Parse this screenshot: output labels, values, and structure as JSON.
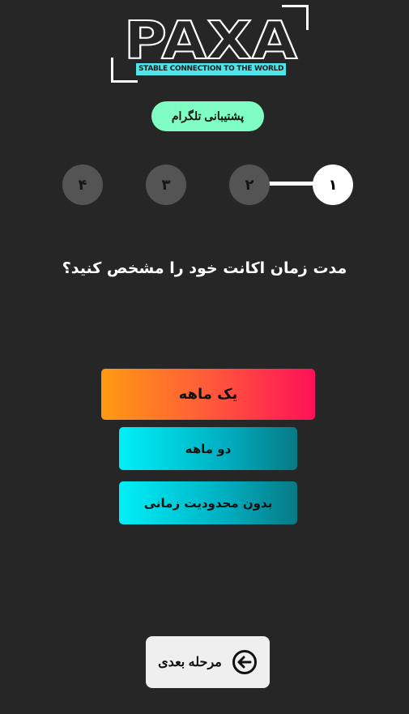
{
  "brand": {
    "name": "PAXA",
    "tagline": "STABLE CONNECTION TO THE WORLD"
  },
  "support": {
    "label": "پشتیبانی تلگرام"
  },
  "stepper": {
    "steps": [
      "۱",
      "۲",
      "۳",
      "۴"
    ],
    "current": 1
  },
  "question": "مدت زمان اکانت خود را مشخص کنید؟",
  "options": [
    {
      "label": "یک ماهه"
    },
    {
      "label": "دو ماهه"
    },
    {
      "label": "بدون محدودیت زمانی"
    }
  ],
  "next": {
    "label": "مرحله بعدی",
    "icon": "arrow-left-circle-icon"
  },
  "colors": {
    "background": "#262626",
    "support": "#7ffdc3",
    "primary_gradient": [
      "#ff9a12",
      "#ff1158"
    ],
    "secondary_gradient": [
      "#00f0f8",
      "#087985"
    ]
  }
}
